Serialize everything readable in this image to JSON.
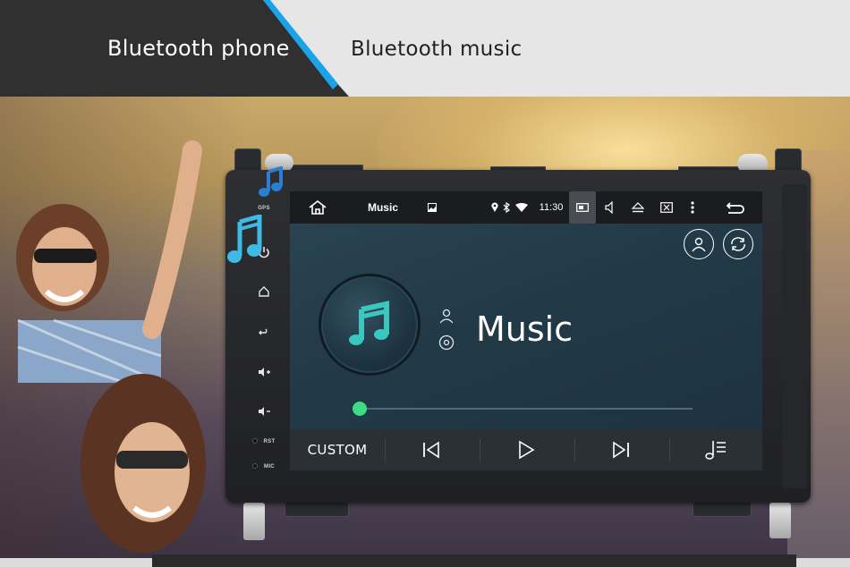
{
  "banner": {
    "left_tab": "Bluetooth phone",
    "right_tab": "Bluetooth music",
    "accent_color": "#1aa3e8"
  },
  "device": {
    "side_panel": {
      "gps_label": "GPS",
      "rst_label": "RST",
      "mic_label": "MIC",
      "icons": [
        "power-icon",
        "home-icon",
        "back-icon",
        "volume-up-icon",
        "volume-down-icon"
      ]
    },
    "statusbar": {
      "app_title": "Music",
      "time": "11:30",
      "icons": [
        "home-icon",
        "image-icon",
        "location-icon",
        "bluetooth-icon",
        "wifi-icon",
        "screen-icon",
        "volume-icon",
        "eject-icon",
        "close-window-icon",
        "more-icon",
        "back-icon"
      ]
    },
    "player": {
      "title": "Music",
      "progress": 0.0,
      "accent_color": "#3ddc84"
    },
    "controls": {
      "custom_label": "CUSTOM",
      "icons": [
        "previous-icon",
        "play-icon",
        "next-icon",
        "playlist-icon"
      ]
    }
  }
}
